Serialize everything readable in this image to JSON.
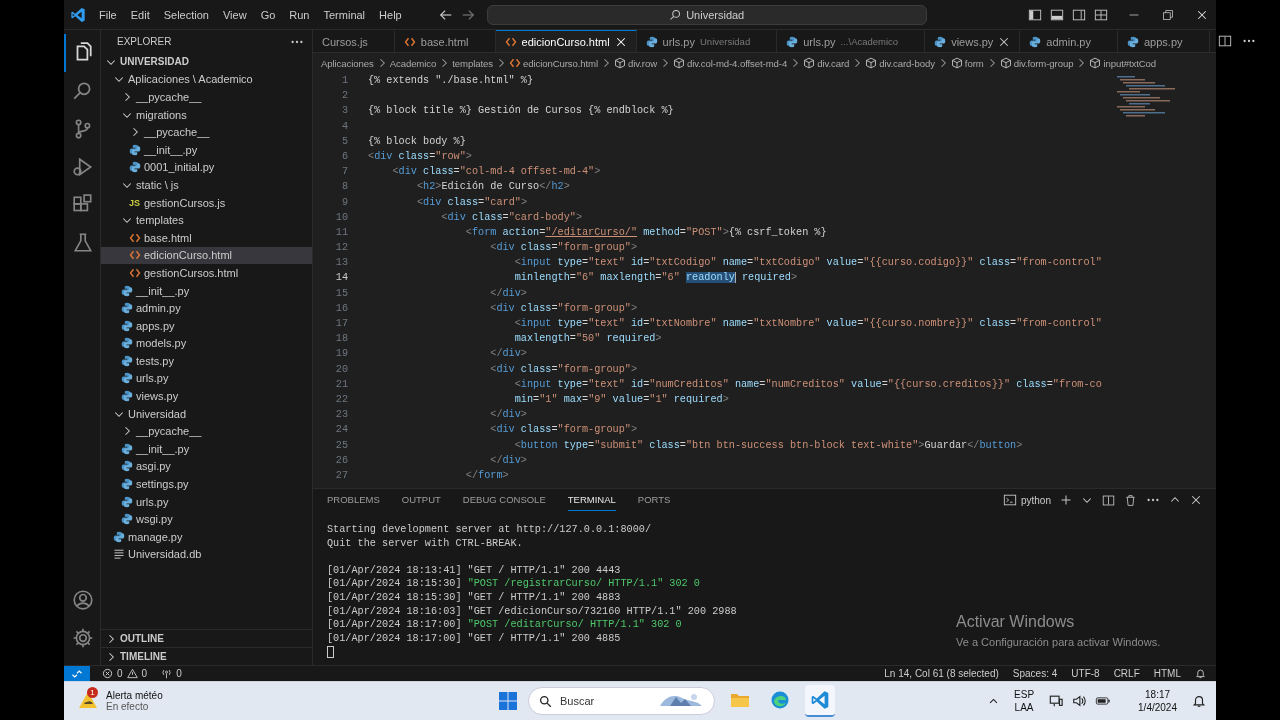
{
  "title_bar": {
    "menus": [
      "File",
      "Edit",
      "Selection",
      "View",
      "Go",
      "Run",
      "Terminal",
      "Help"
    ],
    "search": "Universidad"
  },
  "activity_bar": {
    "items": [
      {
        "selected": true
      },
      {
        "selected": false
      },
      {
        "selected": false
      },
      {
        "selected": false
      },
      {
        "selected": false
      },
      {
        "selected": false
      }
    ]
  },
  "sidebar": {
    "title": "EXPLORER",
    "tree": [
      {
        "label": "UNIVERSIDAD",
        "kind": "root",
        "expanded": true,
        "selected": false,
        "children": [
          {
            "label": "Aplicaciones \\ Academico",
            "kind": "folder",
            "expanded": true,
            "selected": false,
            "children": [
              {
                "label": "__pycache__",
                "kind": "folder",
                "expanded": false,
                "selected": false
              },
              {
                "label": "migrations",
                "kind": "folder",
                "expanded": true,
                "selected": false,
                "children": [
                  {
                    "label": "__pycache__",
                    "kind": "folder",
                    "expanded": false,
                    "selected": false
                  },
                  {
                    "label": "__init__.py",
                    "kind": "python",
                    "selected": false
                  },
                  {
                    "label": "0001_initial.py",
                    "kind": "python",
                    "selected": false
                  }
                ]
              },
              {
                "label": "static \\ js",
                "kind": "folder",
                "expanded": true,
                "selected": false,
                "children": [
                  {
                    "label": "gestionCursos.js",
                    "kind": "js",
                    "icon_text": "JS",
                    "selected": false
                  }
                ]
              },
              {
                "label": "templates",
                "kind": "folder",
                "expanded": true,
                "selected": false,
                "children": [
                  {
                    "label": "base.html",
                    "kind": "html",
                    "selected": false
                  },
                  {
                    "label": "edicionCurso.html",
                    "kind": "html",
                    "selected": true
                  },
                  {
                    "label": "gestionCursos.html",
                    "kind": "html",
                    "selected": false
                  }
                ]
              },
              {
                "label": "__init__.py",
                "kind": "python",
                "selected": false
              },
              {
                "label": "admin.py",
                "kind": "python",
                "selected": false
              },
              {
                "label": "apps.py",
                "kind": "python",
                "selected": false
              },
              {
                "label": "models.py",
                "kind": "python",
                "selected": false
              },
              {
                "label": "tests.py",
                "kind": "python",
                "selected": false
              },
              {
                "label": "urls.py",
                "kind": "python",
                "selected": false
              },
              {
                "label": "views.py",
                "kind": "python",
                "selected": false
              }
            ]
          },
          {
            "label": "Universidad",
            "kind": "folder",
            "expanded": true,
            "selected": false,
            "children": [
              {
                "label": "__pycache__",
                "kind": "folder",
                "expanded": false,
                "selected": false
              },
              {
                "label": "__init__.py",
                "kind": "python",
                "selected": false
              },
              {
                "label": "asgi.py",
                "kind": "python",
                "selected": false
              },
              {
                "label": "settings.py",
                "kind": "python",
                "selected": false
              },
              {
                "label": "urls.py",
                "kind": "python",
                "selected": false
              },
              {
                "label": "wsgi.py",
                "kind": "python",
                "selected": false
              }
            ]
          },
          {
            "label": "manage.py",
            "kind": "python",
            "selected": false
          },
          {
            "label": "Universidad.db",
            "kind": "db",
            "selected": false
          }
        ]
      }
    ],
    "sections": [
      {
        "label": "OUTLINE",
        "expanded": false
      },
      {
        "label": "TIMELINE",
        "expanded": false
      }
    ]
  },
  "tabs": [
    {
      "label": "Cursos.js",
      "kind": "none",
      "selected": false,
      "closable": false
    },
    {
      "label": "base.html",
      "kind": "html",
      "selected": false,
      "closable": false
    },
    {
      "label": "edicionCurso.html",
      "kind": "html",
      "selected": true,
      "closable": true
    },
    {
      "label": "urls.py",
      "detail": "Universidad",
      "kind": "python",
      "selected": false,
      "closable": false
    },
    {
      "label": "urls.py",
      "detail": "...\\Academico",
      "kind": "python",
      "selected": false,
      "closable": false
    },
    {
      "label": "views.py",
      "kind": "python",
      "selected": false,
      "closable": true
    },
    {
      "label": "admin.py",
      "kind": "python",
      "selected": false,
      "closable": false
    },
    {
      "label": "apps.py",
      "kind": "python",
      "selected": false,
      "closable": false
    }
  ],
  "breadcrumbs": [
    {
      "label": "Aplicaciones",
      "kind": "folder"
    },
    {
      "label": "Academico",
      "kind": "folder"
    },
    {
      "label": "templates",
      "kind": "folder"
    },
    {
      "label": "edicionCurso.html",
      "kind": "html"
    },
    {
      "label": "div.row",
      "kind": "element"
    },
    {
      "label": "div.col-md-4.offset-md-4",
      "kind": "element"
    },
    {
      "label": "div.card",
      "kind": "element"
    },
    {
      "label": "div.card-body",
      "kind": "element"
    },
    {
      "label": "form",
      "kind": "element"
    },
    {
      "label": "div.form-group",
      "kind": "element"
    },
    {
      "label": "input#txtCod",
      "kind": "element"
    }
  ],
  "editor": {
    "lines": [
      {
        "number": "1",
        "current": false,
        "tokens": [
          {
            "kind": "text",
            "text": "{% extends \"./base.html\" %}"
          }
        ]
      },
      {
        "number": "2",
        "current": false
      },
      {
        "number": "3",
        "current": false,
        "tokens": [
          {
            "kind": "text",
            "text": "{% block title %} Gestión de Cursos {% endblock %}"
          }
        ]
      },
      {
        "number": "4",
        "current": false
      },
      {
        "number": "5",
        "current": false,
        "tokens": [
          {
            "kind": "text",
            "text": "{% block body %}"
          }
        ]
      },
      {
        "number": "6",
        "current": false,
        "tokens": [
          {
            "kind": "punct",
            "text": "<"
          },
          {
            "kind": "tag",
            "text": "div"
          },
          {
            "kind": "attr",
            "text": " class"
          },
          {
            "kind": "text",
            "text": "="
          },
          {
            "kind": "string",
            "text": "\"row\""
          },
          {
            "kind": "punct",
            "text": ">"
          }
        ]
      },
      {
        "number": "7",
        "current": false,
        "tokens": [
          {
            "kind": "punct",
            "text": "    <"
          },
          {
            "kind": "tag",
            "text": "div"
          },
          {
            "kind": "attr",
            "text": " class"
          },
          {
            "kind": "text",
            "text": "="
          },
          {
            "kind": "string",
            "text": "\"col-md-4 offset-md-4\""
          },
          {
            "kind": "punct",
            "text": ">"
          }
        ]
      },
      {
        "number": "8",
        "current": false,
        "tokens": [
          {
            "kind": "punct",
            "text": "        <"
          },
          {
            "kind": "tag",
            "text": "h2"
          },
          {
            "kind": "punct",
            "text": ">"
          },
          {
            "kind": "text",
            "text": "Edición de Curso"
          },
          {
            "kind": "punct",
            "text": "</"
          },
          {
            "kind": "tag",
            "text": "h2"
          },
          {
            "kind": "punct",
            "text": ">"
          }
        ]
      },
      {
        "number": "9",
        "current": false,
        "tokens": [
          {
            "kind": "punct",
            "text": "        <"
          },
          {
            "kind": "tag",
            "text": "div"
          },
          {
            "kind": "attr",
            "text": " class"
          },
          {
            "kind": "text",
            "text": "="
          },
          {
            "kind": "string",
            "text": "\"card\""
          },
          {
            "kind": "punct",
            "text": ">"
          }
        ]
      },
      {
        "number": "10",
        "current": false,
        "tokens": [
          {
            "kind": "punct",
            "text": "            <"
          },
          {
            "kind": "tag",
            "text": "div"
          },
          {
            "kind": "attr",
            "text": " class"
          },
          {
            "kind": "text",
            "text": "="
          },
          {
            "kind": "string",
            "text": "\"card-body\""
          },
          {
            "kind": "punct",
            "text": ">"
          }
        ]
      },
      {
        "number": "11",
        "current": false,
        "tokens": [
          {
            "kind": "punct",
            "text": "                <"
          },
          {
            "kind": "tag",
            "text": "form"
          },
          {
            "kind": "attr",
            "text": " action"
          },
          {
            "kind": "text",
            "text": "="
          },
          {
            "kind": "link",
            "text": "\"/editarCurso/\""
          },
          {
            "kind": "attr",
            "text": " method"
          },
          {
            "kind": "text",
            "text": "="
          },
          {
            "kind": "string",
            "text": "\"POST\""
          },
          {
            "kind": "punct",
            "text": ">"
          },
          {
            "kind": "text",
            "text": "{% csrf_token %}"
          }
        ]
      },
      {
        "number": "12",
        "current": false,
        "tokens": [
          {
            "kind": "punct",
            "text": "                    <"
          },
          {
            "kind": "tag",
            "text": "div"
          },
          {
            "kind": "attr",
            "text": " class"
          },
          {
            "kind": "text",
            "text": "="
          },
          {
            "kind": "string",
            "text": "\"form-group\""
          },
          {
            "kind": "punct",
            "text": ">"
          }
        ]
      },
      {
        "number": "13",
        "current": false,
        "tokens": [
          {
            "kind": "punct",
            "text": "                        <"
          },
          {
            "kind": "tag",
            "text": "input"
          },
          {
            "kind": "attr",
            "text": " type"
          },
          {
            "kind": "text",
            "text": "="
          },
          {
            "kind": "string",
            "text": "\"text\""
          },
          {
            "kind": "attr",
            "text": " id"
          },
          {
            "kind": "text",
            "text": "="
          },
          {
            "kind": "string",
            "text": "\"txtCodigo\""
          },
          {
            "kind": "attr",
            "text": " name"
          },
          {
            "kind": "text",
            "text": "="
          },
          {
            "kind": "string",
            "text": "\"txtCodigo\""
          },
          {
            "kind": "attr",
            "text": " value"
          },
          {
            "kind": "text",
            "text": "="
          },
          {
            "kind": "string",
            "text": "\"{{curso.codigo}}\""
          },
          {
            "kind": "attr",
            "text": " class"
          },
          {
            "kind": "text",
            "text": "="
          },
          {
            "kind": "string",
            "text": "\"from-control\""
          }
        ]
      },
      {
        "number": "14",
        "current": true,
        "tokens": [
          {
            "kind": "attr",
            "text": "                        minlength"
          },
          {
            "kind": "text",
            "text": "="
          },
          {
            "kind": "string",
            "text": "\"6\""
          },
          {
            "kind": "attr",
            "text": " maxlength"
          },
          {
            "kind": "text",
            "text": "="
          },
          {
            "kind": "string",
            "text": "\"6\" "
          },
          {
            "kind": "selection",
            "text": "readonly"
          },
          {
            "kind": "attr",
            "text": " required"
          },
          {
            "kind": "punct",
            "text": ">"
          }
        ]
      },
      {
        "number": "15",
        "current": false,
        "tokens": [
          {
            "kind": "punct",
            "text": "                    </"
          },
          {
            "kind": "tag",
            "text": "div"
          },
          {
            "kind": "punct",
            "text": ">"
          }
        ]
      },
      {
        "number": "16",
        "current": false,
        "tokens": [
          {
            "kind": "punct",
            "text": "                    <"
          },
          {
            "kind": "tag",
            "text": "div"
          },
          {
            "kind": "attr",
            "text": " class"
          },
          {
            "kind": "text",
            "text": "="
          },
          {
            "kind": "string",
            "text": "\"form-group\""
          },
          {
            "kind": "punct",
            "text": ">"
          }
        ]
      },
      {
        "number": "17",
        "current": false,
        "tokens": [
          {
            "kind": "punct",
            "text": "                        <"
          },
          {
            "kind": "tag",
            "text": "input"
          },
          {
            "kind": "attr",
            "text": " type"
          },
          {
            "kind": "text",
            "text": "="
          },
          {
            "kind": "string",
            "text": "\"text\""
          },
          {
            "kind": "attr",
            "text": " id"
          },
          {
            "kind": "text",
            "text": "="
          },
          {
            "kind": "string",
            "text": "\"txtNombre\""
          },
          {
            "kind": "attr",
            "text": " name"
          },
          {
            "kind": "text",
            "text": "="
          },
          {
            "kind": "string",
            "text": "\"txtNombre\""
          },
          {
            "kind": "attr",
            "text": " value"
          },
          {
            "kind": "text",
            "text": "="
          },
          {
            "kind": "string",
            "text": "\"{{curso.nombre}}\""
          },
          {
            "kind": "attr",
            "text": " class"
          },
          {
            "kind": "text",
            "text": "="
          },
          {
            "kind": "string",
            "text": "\"from-control\""
          }
        ]
      },
      {
        "number": "18",
        "current": false,
        "tokens": [
          {
            "kind": "attr",
            "text": "                        maxlength"
          },
          {
            "kind": "text",
            "text": "="
          },
          {
            "kind": "string",
            "text": "\"50\""
          },
          {
            "kind": "attr",
            "text": " required"
          },
          {
            "kind": "punct",
            "text": ">"
          }
        ]
      },
      {
        "number": "19",
        "current": false,
        "tokens": [
          {
            "kind": "punct",
            "text": "                    </"
          },
          {
            "kind": "tag",
            "text": "div"
          },
          {
            "kind": "punct",
            "text": ">"
          }
        ]
      },
      {
        "number": "20",
        "current": false,
        "tokens": [
          {
            "kind": "punct",
            "text": "                    <"
          },
          {
            "kind": "tag",
            "text": "div"
          },
          {
            "kind": "attr",
            "text": " class"
          },
          {
            "kind": "text",
            "text": "="
          },
          {
            "kind": "string",
            "text": "\"form-group\""
          },
          {
            "kind": "punct",
            "text": ">"
          }
        ]
      },
      {
        "number": "21",
        "current": false,
        "tokens": [
          {
            "kind": "punct",
            "text": "                        <"
          },
          {
            "kind": "tag",
            "text": "input"
          },
          {
            "kind": "attr",
            "text": " type"
          },
          {
            "kind": "text",
            "text": "="
          },
          {
            "kind": "string",
            "text": "\"text\""
          },
          {
            "kind": "attr",
            "text": " id"
          },
          {
            "kind": "text",
            "text": "="
          },
          {
            "kind": "string",
            "text": "\"numCreditos\""
          },
          {
            "kind": "attr",
            "text": " name"
          },
          {
            "kind": "text",
            "text": "="
          },
          {
            "kind": "string",
            "text": "\"numCreditos\""
          },
          {
            "kind": "attr",
            "text": " value"
          },
          {
            "kind": "text",
            "text": "="
          },
          {
            "kind": "string",
            "text": "\"{{curso.creditos}}\""
          },
          {
            "kind": "attr",
            "text": " class"
          },
          {
            "kind": "text",
            "text": "="
          },
          {
            "kind": "string",
            "text": "\"from-co"
          }
        ]
      },
      {
        "number": "22",
        "current": false,
        "tokens": [
          {
            "kind": "attr",
            "text": "                        min"
          },
          {
            "kind": "text",
            "text": "="
          },
          {
            "kind": "string",
            "text": "\"1\""
          },
          {
            "kind": "attr",
            "text": " max"
          },
          {
            "kind": "text",
            "text": "="
          },
          {
            "kind": "string",
            "text": "\"9\""
          },
          {
            "kind": "attr",
            "text": " value"
          },
          {
            "kind": "text",
            "text": "="
          },
          {
            "kind": "string",
            "text": "\"1\""
          },
          {
            "kind": "attr",
            "text": " required"
          },
          {
            "kind": "punct",
            "text": ">"
          }
        ]
      },
      {
        "number": "23",
        "current": false,
        "tokens": [
          {
            "kind": "punct",
            "text": "                    </"
          },
          {
            "kind": "tag",
            "text": "div"
          },
          {
            "kind": "punct",
            "text": ">"
          }
        ]
      },
      {
        "number": "24",
        "current": false,
        "tokens": [
          {
            "kind": "punct",
            "text": "                    <"
          },
          {
            "kind": "tag",
            "text": "div"
          },
          {
            "kind": "attr",
            "text": " class"
          },
          {
            "kind": "text",
            "text": "="
          },
          {
            "kind": "string",
            "text": "\"form-group\""
          },
          {
            "kind": "punct",
            "text": ">"
          }
        ]
      },
      {
        "number": "25",
        "current": false,
        "tokens": [
          {
            "kind": "punct",
            "text": "                        <"
          },
          {
            "kind": "tag",
            "text": "button"
          },
          {
            "kind": "attr",
            "text": " type"
          },
          {
            "kind": "text",
            "text": "="
          },
          {
            "kind": "string",
            "text": "\"submit\""
          },
          {
            "kind": "attr",
            "text": " class"
          },
          {
            "kind": "text",
            "text": "="
          },
          {
            "kind": "string",
            "text": "\"btn btn-success btn-block text-white\""
          },
          {
            "kind": "punct",
            "text": ">"
          },
          {
            "kind": "text",
            "text": "Guardar"
          },
          {
            "kind": "punct",
            "text": "</"
          },
          {
            "kind": "tag",
            "text": "button"
          },
          {
            "kind": "punct",
            "text": ">"
          }
        ]
      },
      {
        "number": "26",
        "current": false,
        "tokens": [
          {
            "kind": "punct",
            "text": "                    </"
          },
          {
            "kind": "tag",
            "text": "div"
          },
          {
            "kind": "punct",
            "text": ">"
          }
        ]
      },
      {
        "number": "27",
        "current": false,
        "tokens": [
          {
            "kind": "punct",
            "text": "                </"
          },
          {
            "kind": "tag",
            "text": "form"
          },
          {
            "kind": "punct",
            "text": ">"
          }
        ]
      }
    ]
  },
  "panel": {
    "tabs": [
      {
        "label": "PROBLEMS",
        "selected": false
      },
      {
        "label": "OUTPUT",
        "selected": false
      },
      {
        "label": "DEBUG CONSOLE",
        "selected": false
      },
      {
        "label": "TERMINAL",
        "selected": true
      },
      {
        "label": "PORTS",
        "selected": false
      }
    ],
    "terminal_name": "python",
    "lines": [
      {
        "kind": "normal",
        "text": "Starting development server at http://127.0.0.1:8000/"
      },
      {
        "kind": "normal",
        "text": "Quit the server with CTRL-BREAK."
      },
      {
        "kind": "normal"
      },
      {
        "kind": "normal",
        "text": "[01/Apr/2024 18:13:41] \"GET / HTTP/1.1\" 200 4443"
      },
      {
        "kind": "split",
        "text": "[01/Apr/2024 18:15:30] ",
        "highlight": "\"POST /registrarCurso/ HTTP/1.1\" 302 0"
      },
      {
        "kind": "normal",
        "text": "[01/Apr/2024 18:15:30] \"GET / HTTP/1.1\" 200 4883"
      },
      {
        "kind": "normal",
        "text": "[01/Apr/2024 18:16:03] \"GET /edicionCurso/732160 HTTP/1.1\" 200 2988"
      },
      {
        "kind": "split",
        "text": "[01/Apr/2024 18:17:00] ",
        "highlight": "\"POST /editarCurso/ HTTP/1.1\" 302 0"
      },
      {
        "kind": "normal",
        "text": "[01/Apr/2024 18:17:00] \"GET / HTTP/1.1\" 200 4885"
      }
    ]
  },
  "activation_notice": {
    "title": "Activar Windows",
    "text": "Ve a Configuración para activar Windows."
  },
  "status_bar": {
    "errors": "0",
    "warnings": "0",
    "ports": "0",
    "items": [
      "Ln 14, Col 61 (8 selected)",
      "Spaces: 4",
      "UTF-8",
      "CRLF",
      "HTML"
    ]
  },
  "taskbar": {
    "weather": {
      "badge": "1",
      "title": "Alerta météo",
      "subtitle": "En efecto"
    },
    "search": "Buscar",
    "apps": [
      {
        "selected": false
      },
      {
        "selected": false
      },
      {
        "selected": true
      }
    ],
    "language": "ESP",
    "layout": "LAA",
    "time": "18:17",
    "date": "1/4/2024"
  }
}
